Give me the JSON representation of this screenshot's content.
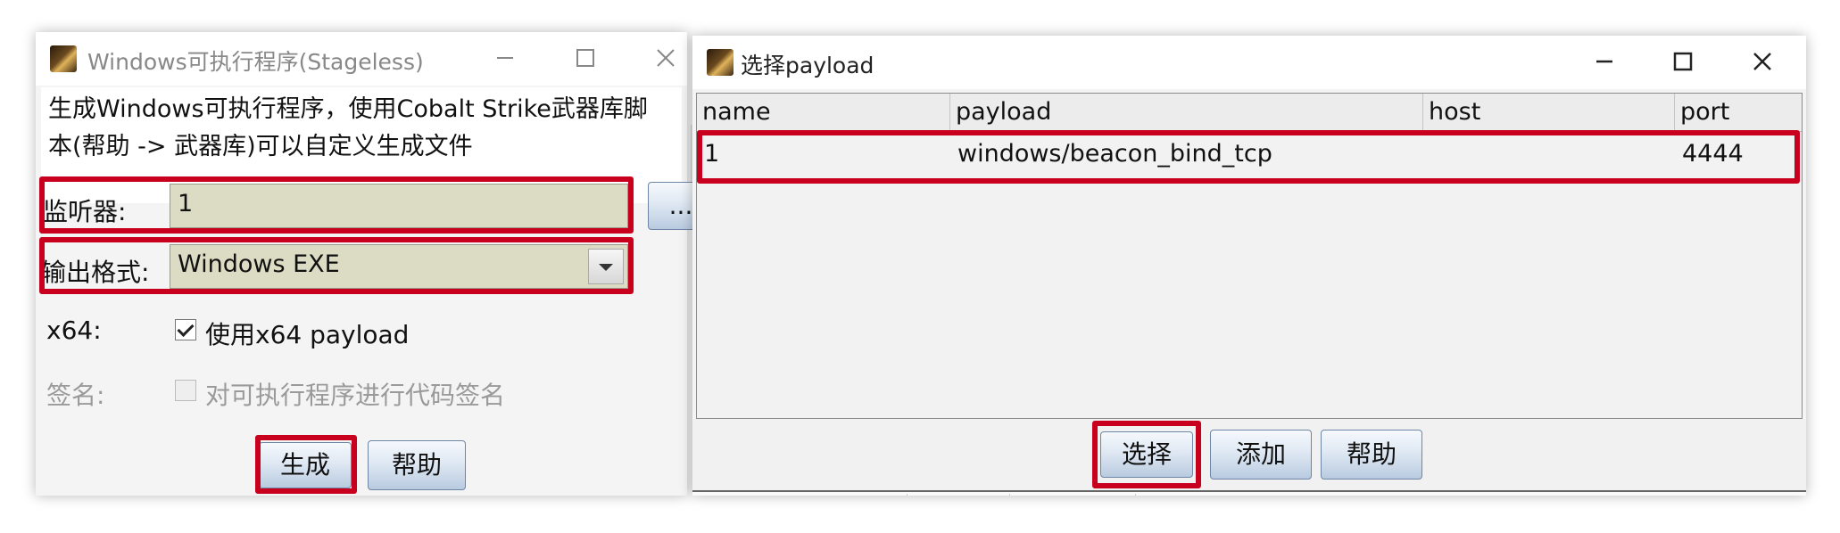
{
  "left_window": {
    "title": "Windows可执行程序(Stageless)",
    "description": [
      "生成Windows可执行程序，使用Cobalt Strike武器库脚",
      "本(帮助 -> 武器库)可以自定义生成文件"
    ],
    "listener": {
      "label": "监听器:",
      "value": "1",
      "browse_label": "..."
    },
    "output_format": {
      "label": "输出格式:",
      "value": "Windows EXE"
    },
    "x64": {
      "label": "x64:",
      "checkbox_label": "使用x64 payload",
      "checked": true
    },
    "sign": {
      "label": "签名:",
      "checkbox_label": "对可执行程序进行代码签名",
      "checked": false,
      "enabled": false
    },
    "buttons": {
      "generate": "生成",
      "help": "帮助"
    }
  },
  "right_window": {
    "title": "选择payload",
    "columns": [
      "name",
      "payload",
      "host",
      "port"
    ],
    "rows": [
      {
        "name": "1",
        "payload": "windows/beacon_bind_tcp",
        "host": "",
        "port": "4444"
      }
    ],
    "buttons": {
      "select": "选择",
      "add": "添加",
      "help": "帮助"
    }
  },
  "highlight_color": "#c8001e",
  "icons": [
    "app-icon",
    "minimize-icon",
    "maximize-icon",
    "close-icon",
    "scroll-up-icon",
    "scroll-down-icon",
    "chevron-down-icon",
    "checkbox-icon"
  ]
}
